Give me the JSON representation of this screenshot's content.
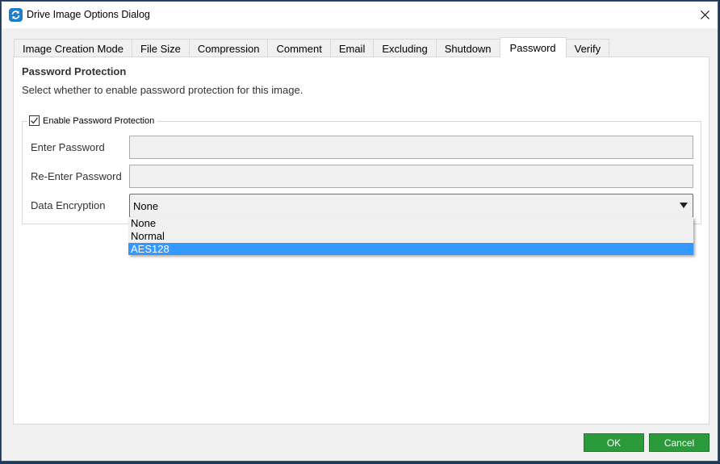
{
  "window": {
    "title": "Drive Image Options Dialog",
    "icon": "sync-arrows-icon",
    "close_icon": "close-icon"
  },
  "tabs": [
    {
      "label": "Image Creation Mode",
      "active": false
    },
    {
      "label": "File Size",
      "active": false
    },
    {
      "label": "Compression",
      "active": false
    },
    {
      "label": "Comment",
      "active": false
    },
    {
      "label": "Email",
      "active": false
    },
    {
      "label": "Excluding",
      "active": false
    },
    {
      "label": "Shutdown",
      "active": false
    },
    {
      "label": "Password",
      "active": true
    },
    {
      "label": "Verify",
      "active": false
    }
  ],
  "panel": {
    "title": "Password Protection",
    "description": "Select whether to enable password protection for this image.",
    "group": {
      "checkbox_label": "Enable Password Protection",
      "checked": true
    },
    "fields": {
      "enter_password": {
        "label": "Enter Password",
        "value": ""
      },
      "reenter_password": {
        "label": "Re-Enter Password",
        "value": ""
      },
      "data_encryption": {
        "label": "Data Encryption",
        "value": "None",
        "options": [
          "None",
          "Normal",
          "AES128"
        ],
        "highlighted": "AES128"
      }
    }
  },
  "buttons": {
    "ok": "OK",
    "cancel": "Cancel"
  },
  "colors": {
    "accent_button": "#2a9a3a",
    "selection": "#3399ff",
    "window_border": "#2b579a"
  }
}
